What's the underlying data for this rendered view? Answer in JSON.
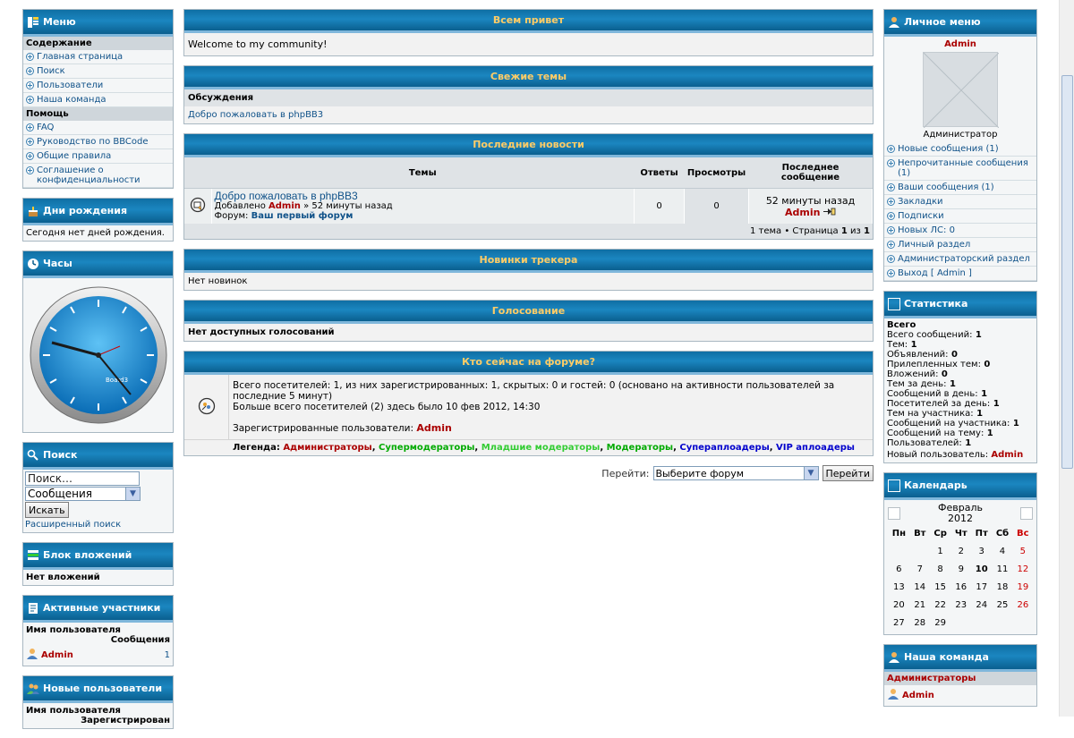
{
  "left": {
    "menu": {
      "title": "Меню",
      "section_content": "Содержание",
      "content_items": [
        "Главная страница",
        "Поиск",
        "Пользователи",
        "Наша команда"
      ],
      "section_help": "Помощь",
      "help_items": [
        "FAQ",
        "Руководство по BBCode",
        "Общие правила",
        "Соглашение о конфиденциальности"
      ]
    },
    "birthdays": {
      "title": "Дни рождения",
      "text": "Сегодня нет дней рождения."
    },
    "clock": {
      "title": "Часы",
      "brand": "Board3"
    },
    "search": {
      "title": "Поиск",
      "placeholder": "Поиск…",
      "select_value": "Сообщения",
      "button": "Искать",
      "advanced": "Расширенный поиск"
    },
    "attachments": {
      "title": "Блок вложений",
      "text": "Нет вложений"
    },
    "active": {
      "title": "Активные участники",
      "col_user": "Имя пользователя",
      "col_posts": "Сообщения",
      "user": "Admin",
      "posts": "1"
    },
    "newusers": {
      "title": "Новые пользователи",
      "col_user": "Имя пользователя",
      "col_reg": "Зарегистрирован"
    }
  },
  "center": {
    "welcome": {
      "title": "Всем привет",
      "text": "Welcome to my community!"
    },
    "recent": {
      "title": "Свежие темы",
      "subhead": "Обсуждения",
      "item": "Добро пожаловать в phpBB3"
    },
    "news": {
      "title": "Последние новости",
      "cols": [
        "Темы",
        "Ответы",
        "Просмотры",
        "Последнее сообщение"
      ],
      "topic": "Добро пожаловать в phpBB3",
      "added_prefix": "Добавлено",
      "added_user": "Admin",
      "added_time": "» 52 минуты назад",
      "forum_prefix": "Форум:",
      "forum": "Ваш первый форум",
      "replies": "0",
      "views": "0",
      "last_time": "52 минуты назад",
      "last_user": "Admin",
      "footer_prefix": "1 тема • Страница",
      "footer_page": "1",
      "footer_of": "из",
      "footer_total": "1"
    },
    "tracker": {
      "title": "Новинки трекера",
      "text": "Нет новинок"
    },
    "poll": {
      "title": "Голосование",
      "text": "Нет доступных голосований"
    },
    "online": {
      "title": "Кто сейчас на форуме?",
      "total_line": "Всего посетителей: 1, из них зарегистрированных: 1, скрытых: 0 и гостей: 0 (основано на активности пользователей за последние 5 минут)",
      "record_line": "Больше всего посетителей (2) здесь было 10 фев 2012, 14:30",
      "registered_prefix": "Зарегистрированные пользователи:",
      "registered_user": "Admin",
      "legend_prefix": "Легенда:",
      "legend": [
        {
          "label": "Администраторы",
          "color": "#aa0000"
        },
        {
          "label": "Супермодераторы",
          "color": "#00aa00"
        },
        {
          "label": "Младшие модераторы",
          "color": "#33cc33"
        },
        {
          "label": "Модераторы",
          "color": "#00aa00"
        },
        {
          "label": "Супераплоадеры",
          "color": "#0000cc"
        },
        {
          "label": "VIP аплоадеры",
          "color": "#0000cc"
        }
      ]
    },
    "jump": {
      "label": "Перейти:",
      "select": "Выберите форум",
      "button": "Перейти"
    }
  },
  "right": {
    "personal": {
      "title": "Личное меню",
      "username": "Admin",
      "rank": "Администратор",
      "items": [
        "Новые сообщения (1)",
        "Непрочитанные сообщения (1)",
        "Ваши сообщения (1)",
        "Закладки",
        "Подписки",
        "Новых ЛС: 0",
        "Личный раздел",
        "Администраторский раздел",
        "Выход [ Admin ]"
      ]
    },
    "stats": {
      "title": "Статистика",
      "lines": [
        [
          "Всего",
          ""
        ],
        [
          "Всего сообщений:",
          "1"
        ],
        [
          "Тем:",
          "1"
        ],
        [
          "Объявлений:",
          "0"
        ],
        [
          "Прилепленных тем:",
          "0"
        ],
        [
          "Вложений:",
          "0"
        ],
        [
          "Тем за день:",
          "1"
        ],
        [
          "Сообщений в день:",
          "1"
        ],
        [
          "Посетителей за день:",
          "1"
        ],
        [
          "Тем на участника:",
          "1"
        ],
        [
          "Сообщений на участника:",
          "1"
        ],
        [
          "Сообщений на тему:",
          "1"
        ],
        [
          "Пользователей:",
          "1"
        ]
      ],
      "newest_prefix": "Новый пользователь:",
      "newest_user": "Admin"
    },
    "calendar": {
      "title": "Календарь",
      "month": "Февраль",
      "year": "2012",
      "days": [
        "Пн",
        "Вт",
        "Ср",
        "Чт",
        "Пт",
        "Сб",
        "Вс"
      ],
      "weeks": [
        [
          "",
          "",
          "1",
          "2",
          "3",
          "4",
          "5"
        ],
        [
          "6",
          "7",
          "8",
          "9",
          "10",
          "11",
          "12"
        ],
        [
          "13",
          "14",
          "15",
          "16",
          "17",
          "18",
          "19"
        ],
        [
          "20",
          "21",
          "22",
          "23",
          "24",
          "25",
          "26"
        ],
        [
          "27",
          "28",
          "29",
          "",
          "",
          "",
          ""
        ]
      ],
      "today": "10"
    },
    "team": {
      "title": "Наша команда",
      "group": "Администраторы",
      "user": "Admin"
    }
  }
}
